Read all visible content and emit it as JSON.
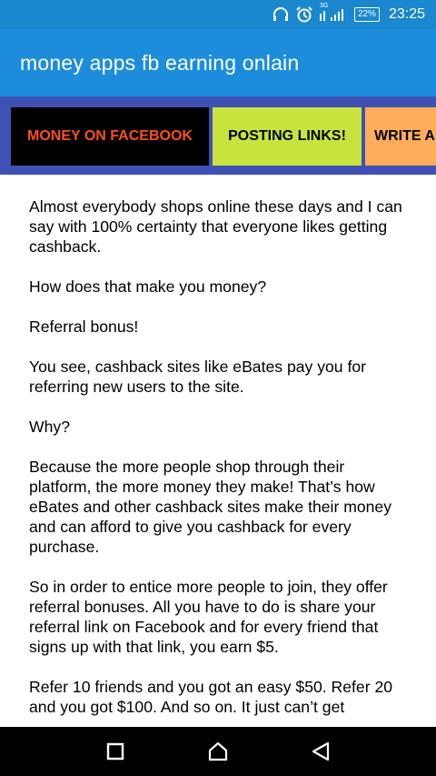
{
  "status_bar": {
    "network_label": "3G",
    "battery": "22%",
    "time": "23:25",
    "icons": [
      "headset-icon",
      "alarm-icon",
      "signal-icon",
      "battery-icon"
    ]
  },
  "app_bar": {
    "title": "money apps fb earning onlain"
  },
  "tabs": [
    {
      "label": "MONEY ON FACEBOOK",
      "color": "#ff4d1f",
      "background": "#000000"
    },
    {
      "label": "POSTING LINKS!",
      "color": "#000000",
      "background": "#c9e33e"
    },
    {
      "label": "WRITE A",
      "color": "#000000",
      "background": "#ffad5a"
    }
  ],
  "article": {
    "paragraphs": [
      "Almost everybody shops online these days and I can say with 100% certainty that everyone likes getting cashback.",
      "How does that make you money?",
      "Referral bonus!",
      "You see, cashback sites like eBates pay you for referring new users to the site.",
      "Why?",
      "Because the more people shop through their platform, the more money they make! That’s how eBates and other cashback sites make their money and can afford to give you cashback for every purchase.",
      "So in order to entice more people to join, they offer referral bonuses. All you have to do is share your referral link on Facebook and for every friend that signs up with that link, you earn $5.",
      "Refer 10 friends and you got an easy $50. Refer 20 and you got $100. And so on. It just can’t get"
    ]
  },
  "nav_bar": {
    "icons": [
      "recents-square-icon",
      "home-icon",
      "back-triangle-icon"
    ]
  },
  "colors": {
    "status_bar": "#1a87cf",
    "app_bar": "#1d8ddb",
    "tab_strip": "#3f51b5"
  }
}
